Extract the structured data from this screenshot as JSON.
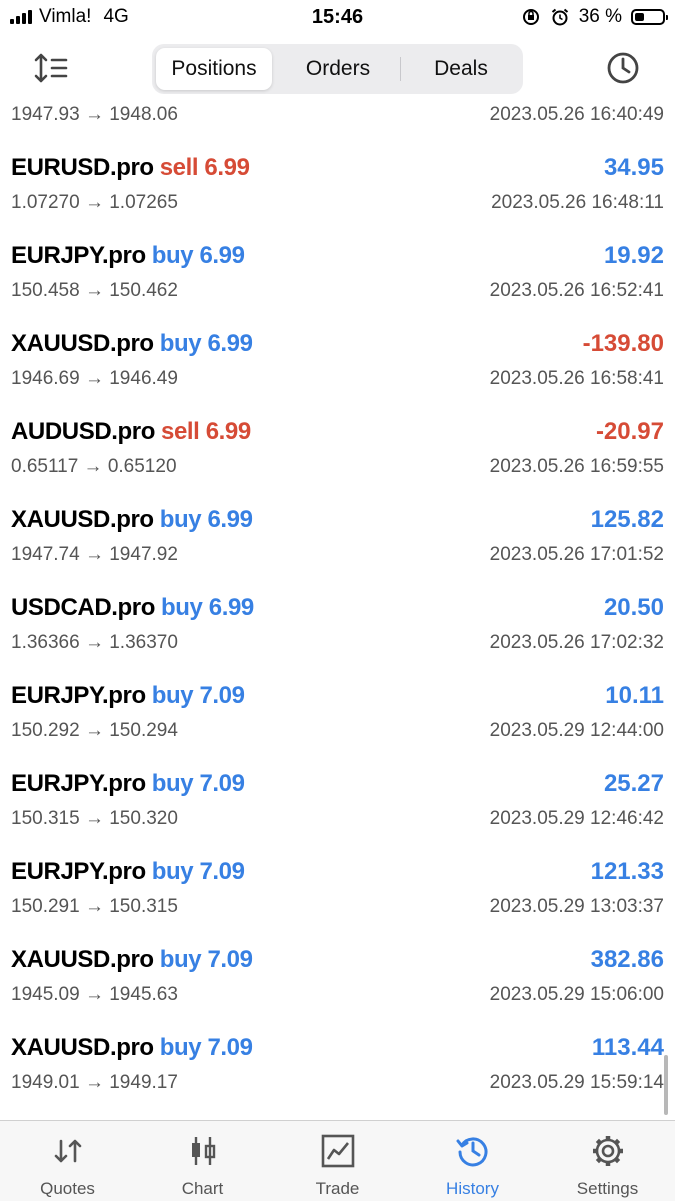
{
  "status_bar": {
    "carrier": "Vimla!",
    "network": "4G",
    "time": "15:46",
    "battery": "36 %",
    "battery_level": 0.36
  },
  "header": {
    "tabs": [
      {
        "label": "Positions",
        "active": true
      },
      {
        "label": "Orders",
        "active": false
      },
      {
        "label": "Deals",
        "active": false
      }
    ],
    "sort_icon": "sort-icon",
    "history_icon": "clock-icon"
  },
  "colors": {
    "buy": "#3780e3",
    "sell": "#d64b36",
    "profit_positive": "#3780e3",
    "profit_negative": "#d64b36",
    "tab_active": "#3780e3"
  },
  "partial_row": {
    "prices": "1947.93 → 1948.06",
    "time": "2023.05.26 16:40:49"
  },
  "deals": [
    {
      "symbol": "EURUSD.pro",
      "side": "sell",
      "volume": "6.99",
      "profit": "34.95",
      "prices": "1.07270 → 1.07265",
      "time": "2023.05.26 16:48:11"
    },
    {
      "symbol": "EURJPY.pro",
      "side": "buy",
      "volume": "6.99",
      "profit": "19.92",
      "prices": "150.458 → 150.462",
      "time": "2023.05.26 16:52:41"
    },
    {
      "symbol": "XAUUSD.pro",
      "side": "buy",
      "volume": "6.99",
      "profit": "-139.80",
      "prices": "1946.69 → 1946.49",
      "time": "2023.05.26 16:58:41"
    },
    {
      "symbol": "AUDUSD.pro",
      "side": "sell",
      "volume": "6.99",
      "profit": "-20.97",
      "prices": "0.65117 → 0.65120",
      "time": "2023.05.26 16:59:55"
    },
    {
      "symbol": "XAUUSD.pro",
      "side": "buy",
      "volume": "6.99",
      "profit": "125.82",
      "prices": "1947.74 → 1947.92",
      "time": "2023.05.26 17:01:52"
    },
    {
      "symbol": "USDCAD.pro",
      "side": "buy",
      "volume": "6.99",
      "profit": "20.50",
      "prices": "1.36366 → 1.36370",
      "time": "2023.05.26 17:02:32"
    },
    {
      "symbol": "EURJPY.pro",
      "side": "buy",
      "volume": "7.09",
      "profit": "10.11",
      "prices": "150.292 → 150.294",
      "time": "2023.05.29 12:44:00"
    },
    {
      "symbol": "EURJPY.pro",
      "side": "buy",
      "volume": "7.09",
      "profit": "25.27",
      "prices": "150.315 → 150.320",
      "time": "2023.05.29 12:46:42"
    },
    {
      "symbol": "EURJPY.pro",
      "side": "buy",
      "volume": "7.09",
      "profit": "121.33",
      "prices": "150.291 → 150.315",
      "time": "2023.05.29 13:03:37"
    },
    {
      "symbol": "XAUUSD.pro",
      "side": "buy",
      "volume": "7.09",
      "profit": "382.86",
      "prices": "1945.09 → 1945.63",
      "time": "2023.05.29 15:06:00"
    },
    {
      "symbol": "XAUUSD.pro",
      "side": "buy",
      "volume": "7.09",
      "profit": "113.44",
      "prices": "1949.01 → 1949.17",
      "time": "2023.05.29 15:59:14"
    }
  ],
  "tabbar": {
    "items": [
      {
        "label": "Quotes",
        "icon": "quotes-icon",
        "active": false
      },
      {
        "label": "Chart",
        "icon": "candlestick-icon",
        "active": false
      },
      {
        "label": "Trade",
        "icon": "trade-chart-icon",
        "active": false
      },
      {
        "label": "History",
        "icon": "history-icon",
        "active": true
      },
      {
        "label": "Settings",
        "icon": "gear-icon",
        "active": false
      }
    ]
  }
}
